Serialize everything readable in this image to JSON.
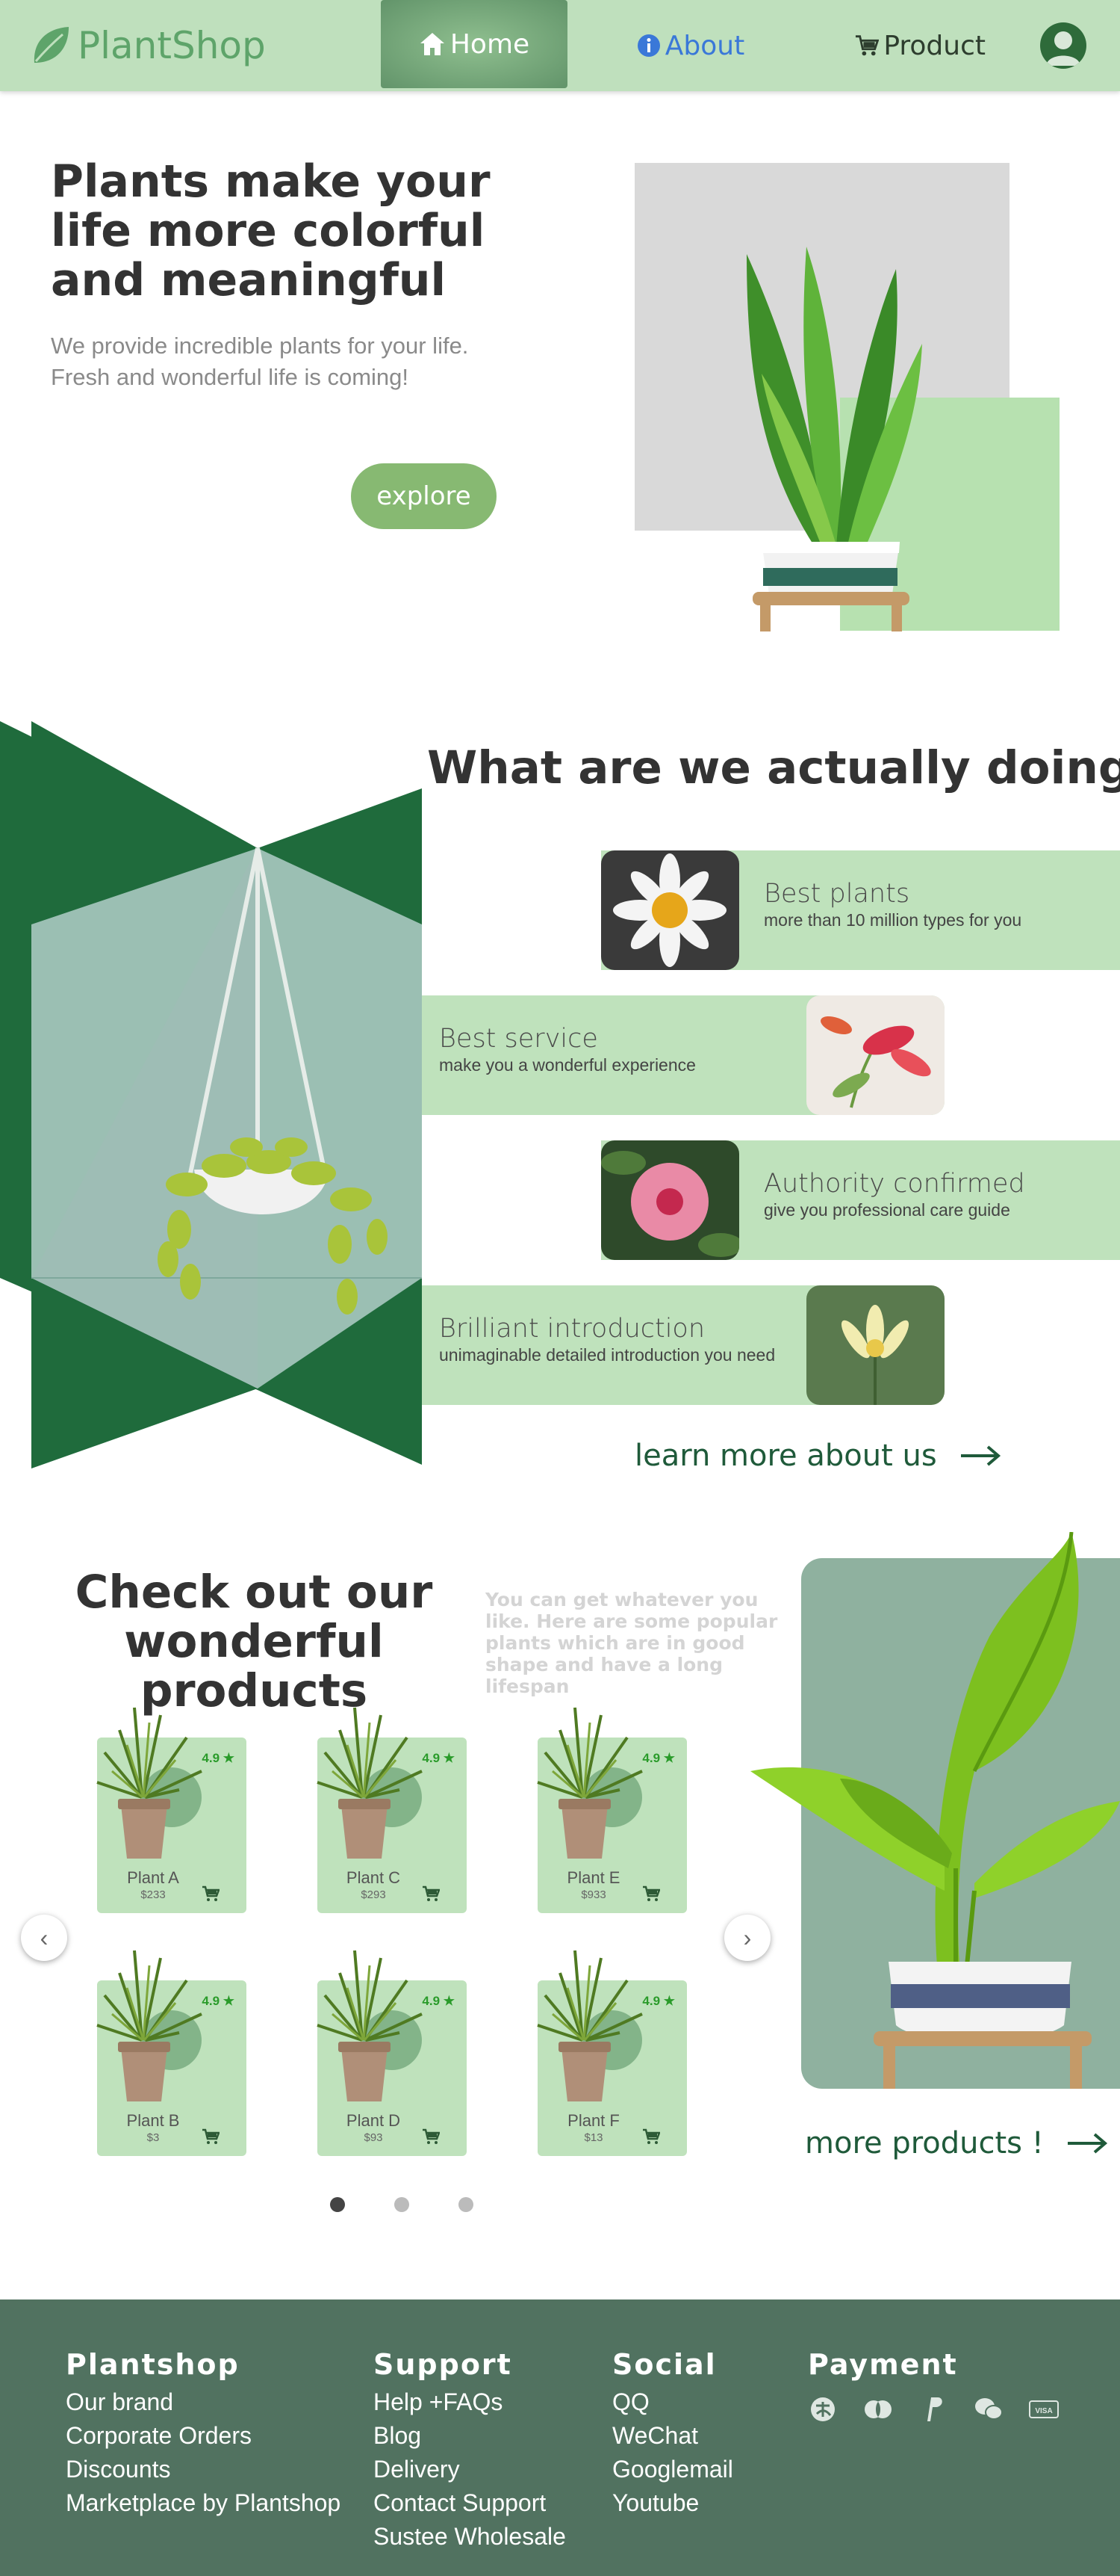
{
  "nav": {
    "brand": "PlantShop",
    "items": [
      {
        "label": "Home",
        "icon": "home-icon"
      },
      {
        "label": "About",
        "icon": "info-icon"
      },
      {
        "label": "Product",
        "icon": "cart-icon"
      }
    ],
    "avatar_icon": "user-icon",
    "colors": {
      "bar": "#bfe0bd",
      "active": "#6f9f74",
      "about": "#3a78d8",
      "brand": "#5ea46a"
    }
  },
  "hero": {
    "title": "Plants make your life more colorful and meaningful",
    "subtitle_line1": "We provide incredible plants for your life.",
    "subtitle_line2": "Fresh and wonderful life is coming!",
    "button": "explore"
  },
  "about": {
    "title": "What are we actually doing?",
    "features": [
      {
        "title": "Best plants",
        "desc": "more than 10 million types for you",
        "image": "daisy-photo"
      },
      {
        "title": "Best service",
        "desc": "make you a wonderful experience",
        "image": "lily-photo"
      },
      {
        "title": "Authority confirmed",
        "desc": "give you professional care guide",
        "image": "hibiscus-photo"
      },
      {
        "title": "Brilliant introduction",
        "desc": "unimaginable detailed introduction you need",
        "image": "water-lily-photo"
      }
    ],
    "link": "learn more about us"
  },
  "products": {
    "title": "Check out our wonderful products",
    "subtitle": "You can get whatever you like. Here are some popular plants which are in good shape and have a long lifespan",
    "cards": [
      {
        "name": "Plant A",
        "price": "$233",
        "rating": "4.9 ★"
      },
      {
        "name": "Plant C",
        "price": "$293",
        "rating": "4.9 ★"
      },
      {
        "name": "Plant E",
        "price": "$933",
        "rating": "4.9 ★"
      },
      {
        "name": "Plant B",
        "price": "$3",
        "rating": "4.9 ★"
      },
      {
        "name": "Plant D",
        "price": "$93",
        "rating": "4.9 ★"
      },
      {
        "name": "Plant F",
        "price": "$13",
        "rating": "4.9 ★"
      }
    ],
    "prev": "‹",
    "next": "›",
    "active_page": 1,
    "page_count": 3,
    "more": "more products !"
  },
  "footer": {
    "columns": [
      {
        "title": "Plantshop",
        "links": [
          "Our brand",
          "Corporate Orders",
          "Discounts",
          "Marketplace by Plantshop"
        ]
      },
      {
        "title": "Support",
        "links": [
          "Help +FAQs",
          "Blog",
          "Delivery",
          "Contact Support",
          "Sustee Wholesale"
        ]
      },
      {
        "title": "Social",
        "links": [
          "QQ",
          "WeChat",
          "Googlemail",
          "Youtube"
        ]
      }
    ],
    "payment_title": "Payment",
    "payment_icons": [
      "alipay-icon",
      "mastercard-icon",
      "paypal-icon",
      "wechat-pay-icon",
      "visa-icon"
    ],
    "visa_text": "VISA",
    "bg": "#517260"
  }
}
